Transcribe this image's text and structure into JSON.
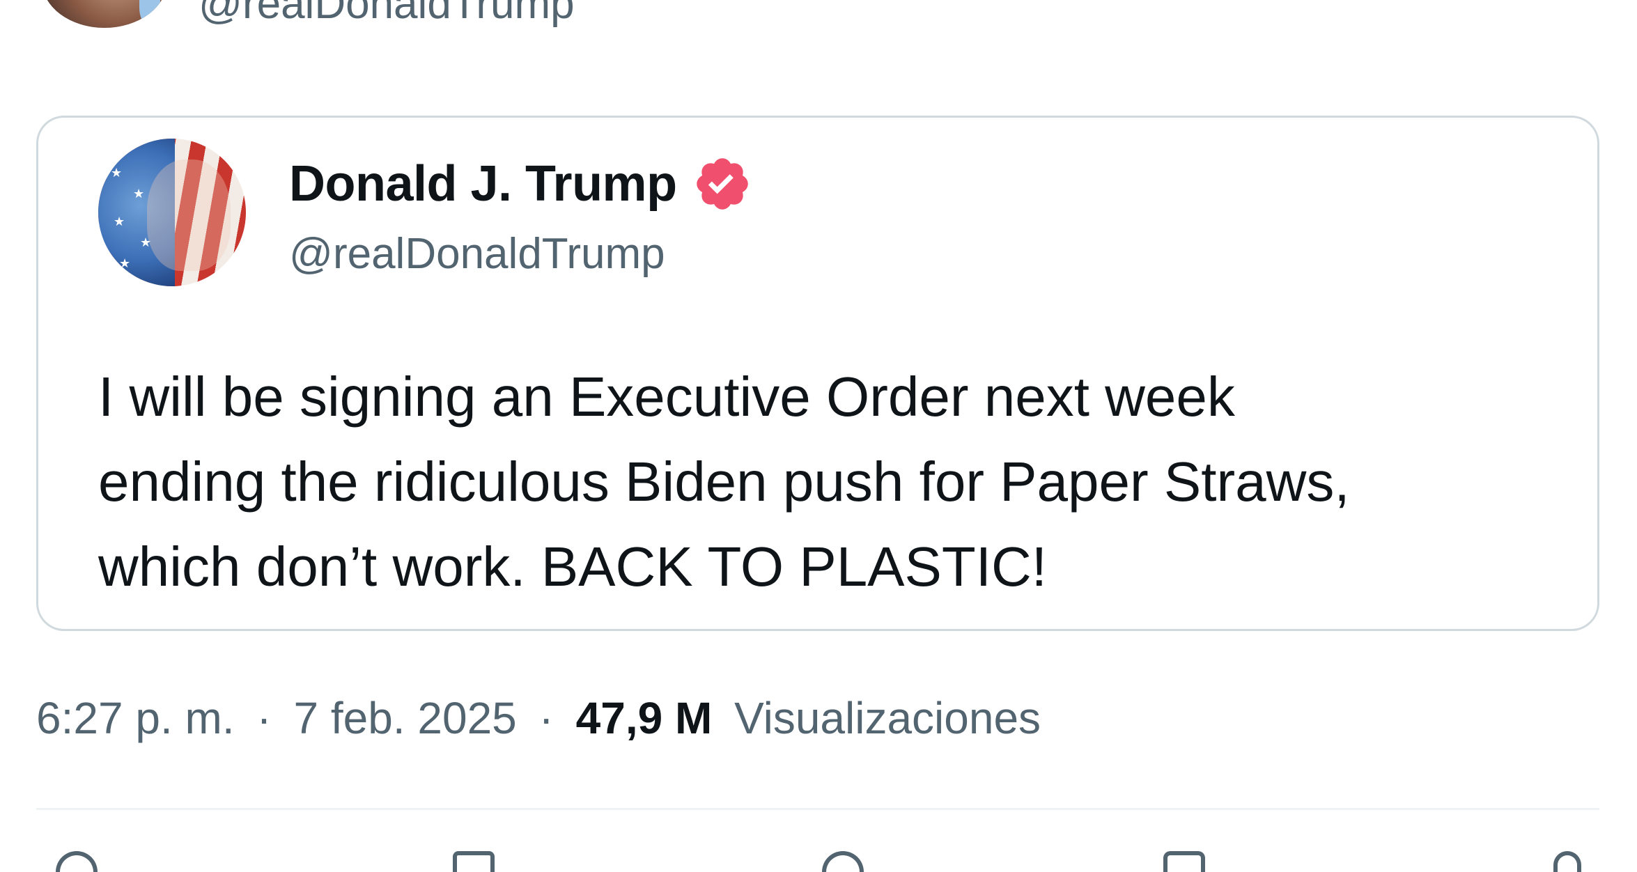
{
  "outer_tweet": {
    "handle": "@realDonaldTrump"
  },
  "quoted_tweet": {
    "display_name": "Donald J. Trump",
    "handle": "@realDonaldTrump",
    "text_lines": [
      "I will be signing an Executive Order next week",
      "ending the ridiculous Biden push for Paper Straws,",
      "which don’t work. BACK TO PLASTIC!"
    ],
    "verified_badge_color": "#f0506e"
  },
  "meta": {
    "time": "6:27 p. m.",
    "separator": "·",
    "date": "7 feb. 2025",
    "views_count": "47,9 M",
    "views_label": "Visualizaciones"
  },
  "actions": [
    {
      "icon": "reply-icon"
    },
    {
      "icon": "repost-icon"
    },
    {
      "icon": "like-icon"
    },
    {
      "icon": "bookmark-icon"
    },
    {
      "icon": "share-icon"
    }
  ]
}
